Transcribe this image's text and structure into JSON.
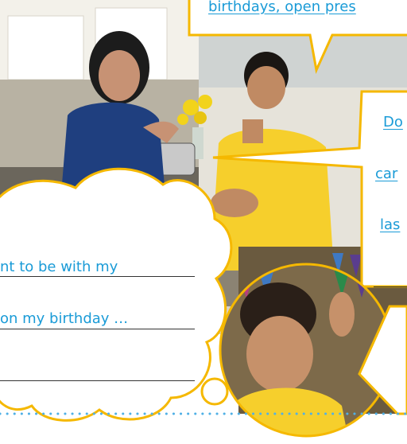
{
  "top_bubble": {
    "text": "birthdays, open pres"
  },
  "right_bubble": {
    "lines": [
      "Do",
      "car",
      "las"
    ]
  },
  "cloud": {
    "lines": [
      "nt to be with my",
      "on my birthday …"
    ]
  },
  "colors": {
    "bubble_border": "#f5b800",
    "text_blue": "#1a9bd7",
    "dots": "#4fb0e6"
  }
}
